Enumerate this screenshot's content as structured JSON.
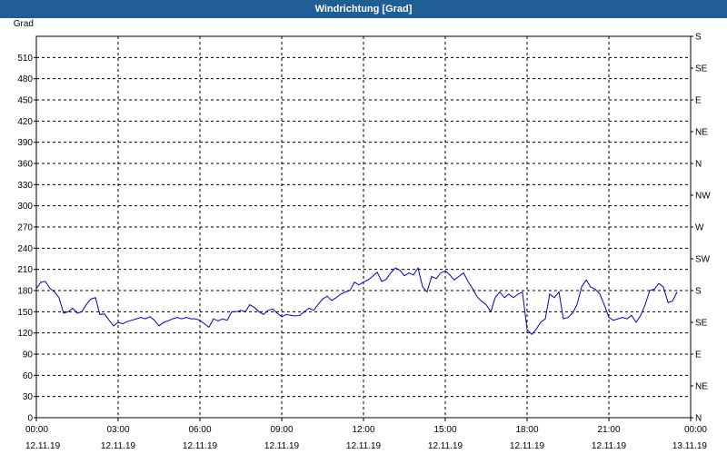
{
  "window": {
    "title": "Windrichtung [Grad]"
  },
  "chart_data": {
    "type": "line",
    "title": "Windrichtung [Grad]",
    "ylabel": "Grad",
    "ylim": [
      0,
      540
    ],
    "y_ticks": [
      0,
      30,
      60,
      90,
      120,
      150,
      180,
      210,
      240,
      270,
      300,
      330,
      360,
      390,
      420,
      450,
      480,
      510
    ],
    "y2_ticks": [
      {
        "value": 0,
        "label": "N"
      },
      {
        "value": 45,
        "label": "NE"
      },
      {
        "value": 90,
        "label": "E"
      },
      {
        "value": 135,
        "label": "SE"
      },
      {
        "value": 180,
        "label": "S"
      },
      {
        "value": 225,
        "label": "SW"
      },
      {
        "value": 270,
        "label": "W"
      },
      {
        "value": 315,
        "label": "NW"
      },
      {
        "value": 360,
        "label": "N"
      },
      {
        "value": 405,
        "label": "NE"
      },
      {
        "value": 450,
        "label": "E"
      },
      {
        "value": 495,
        "label": "SE"
      },
      {
        "value": 540,
        "label": "S"
      }
    ],
    "xlim": [
      0,
      24
    ],
    "x_ticks": [
      {
        "value": 0,
        "time": "00:00",
        "date": "12.11.19"
      },
      {
        "value": 3,
        "time": "03:00",
        "date": "12.11.19"
      },
      {
        "value": 6,
        "time": "06:00",
        "date": "12.11.19"
      },
      {
        "value": 9,
        "time": "09:00",
        "date": "12.11.19"
      },
      {
        "value": 12,
        "time": "12:00",
        "date": "12.11.19"
      },
      {
        "value": 15,
        "time": "15:00",
        "date": "12.11.19"
      },
      {
        "value": 18,
        "time": "18:00",
        "date": "12.11.19"
      },
      {
        "value": 21,
        "time": "21:00",
        "date": "12.11.19"
      },
      {
        "value": 24,
        "time": "00:00",
        "date": "13.11.19"
      }
    ],
    "grid": true,
    "line_color": "#0000cc",
    "x": [
      0,
      0.17,
      0.33,
      0.5,
      0.67,
      0.83,
      1.0,
      1.17,
      1.33,
      1.5,
      1.67,
      1.83,
      2.0,
      2.17,
      2.33,
      2.5,
      2.67,
      2.83,
      3.0,
      3.17,
      3.33,
      3.5,
      3.67,
      3.83,
      4.0,
      4.17,
      4.33,
      4.5,
      4.67,
      4.83,
      5.0,
      5.17,
      5.33,
      5.5,
      5.67,
      5.83,
      6.0,
      6.17,
      6.33,
      6.5,
      6.67,
      6.83,
      7.0,
      7.17,
      7.33,
      7.5,
      7.67,
      7.83,
      8.0,
      8.17,
      8.33,
      8.5,
      8.67,
      8.83,
      9.0,
      9.17,
      9.33,
      9.5,
      9.67,
      9.83,
      10.0,
      10.17,
      10.33,
      10.5,
      10.67,
      10.83,
      11.0,
      11.17,
      11.33,
      11.5,
      11.67,
      11.83,
      12.0,
      12.17,
      12.33,
      12.5,
      12.67,
      12.83,
      13.0,
      13.17,
      13.33,
      13.5,
      13.67,
      13.83,
      14.0,
      14.17,
      14.33,
      14.5,
      14.67,
      14.83,
      15.0,
      15.17,
      15.33,
      15.5,
      15.67,
      15.83,
      16.0,
      16.17,
      16.33,
      16.5,
      16.67,
      16.83,
      17.0,
      17.17,
      17.33,
      17.5,
      17.67,
      17.83,
      18.0,
      18.17,
      18.33,
      18.5,
      18.67,
      18.83,
      19.0,
      19.17,
      19.33,
      19.5,
      19.67,
      19.83,
      20.0,
      20.17,
      20.33,
      20.5,
      20.67,
      20.83,
      21.0,
      21.17,
      21.33,
      21.5,
      21.67,
      21.83,
      22.0,
      22.17,
      22.33,
      22.5,
      22.67,
      22.83,
      23.0,
      23.17,
      23.33,
      23.5,
      23.67,
      23.83
    ],
    "series": [
      {
        "values": [
          183,
          192,
          193,
          183,
          178,
          170,
          148,
          150,
          155,
          148,
          150,
          160,
          168,
          170,
          146,
          147,
          138,
          130,
          135,
          133,
          136,
          138,
          140,
          142,
          140,
          143,
          138,
          130,
          135,
          137,
          140,
          142,
          140,
          142,
          140,
          140,
          138,
          133,
          128,
          140,
          137,
          140,
          138,
          150,
          150,
          152,
          150,
          160,
          156,
          150,
          146,
          152,
          154,
          148,
          143,
          146,
          145,
          144,
          145,
          150,
          155,
          152,
          160,
          168,
          172,
          166,
          170,
          175,
          178,
          180,
          192,
          188,
          192,
          195,
          200,
          206,
          193,
          196,
          205,
          212,
          209,
          201,
          205,
          202,
          212,
          185,
          178,
          200,
          197,
          205,
          208,
          202,
          195,
          200,
          205,
          193,
          183,
          171,
          165,
          160,
          150,
          170,
          178,
          170,
          175,
          170,
          175,
          178,
          125,
          118,
          125,
          135,
          140,
          175,
          170,
          178,
          140,
          142,
          148,
          160,
          185,
          195,
          185,
          182,
          175,
          160,
          142,
          138,
          140,
          142,
          140,
          145,
          135,
          145,
          160,
          180,
          182,
          190,
          185,
          163,
          165,
          178
        ]
      }
    ]
  }
}
